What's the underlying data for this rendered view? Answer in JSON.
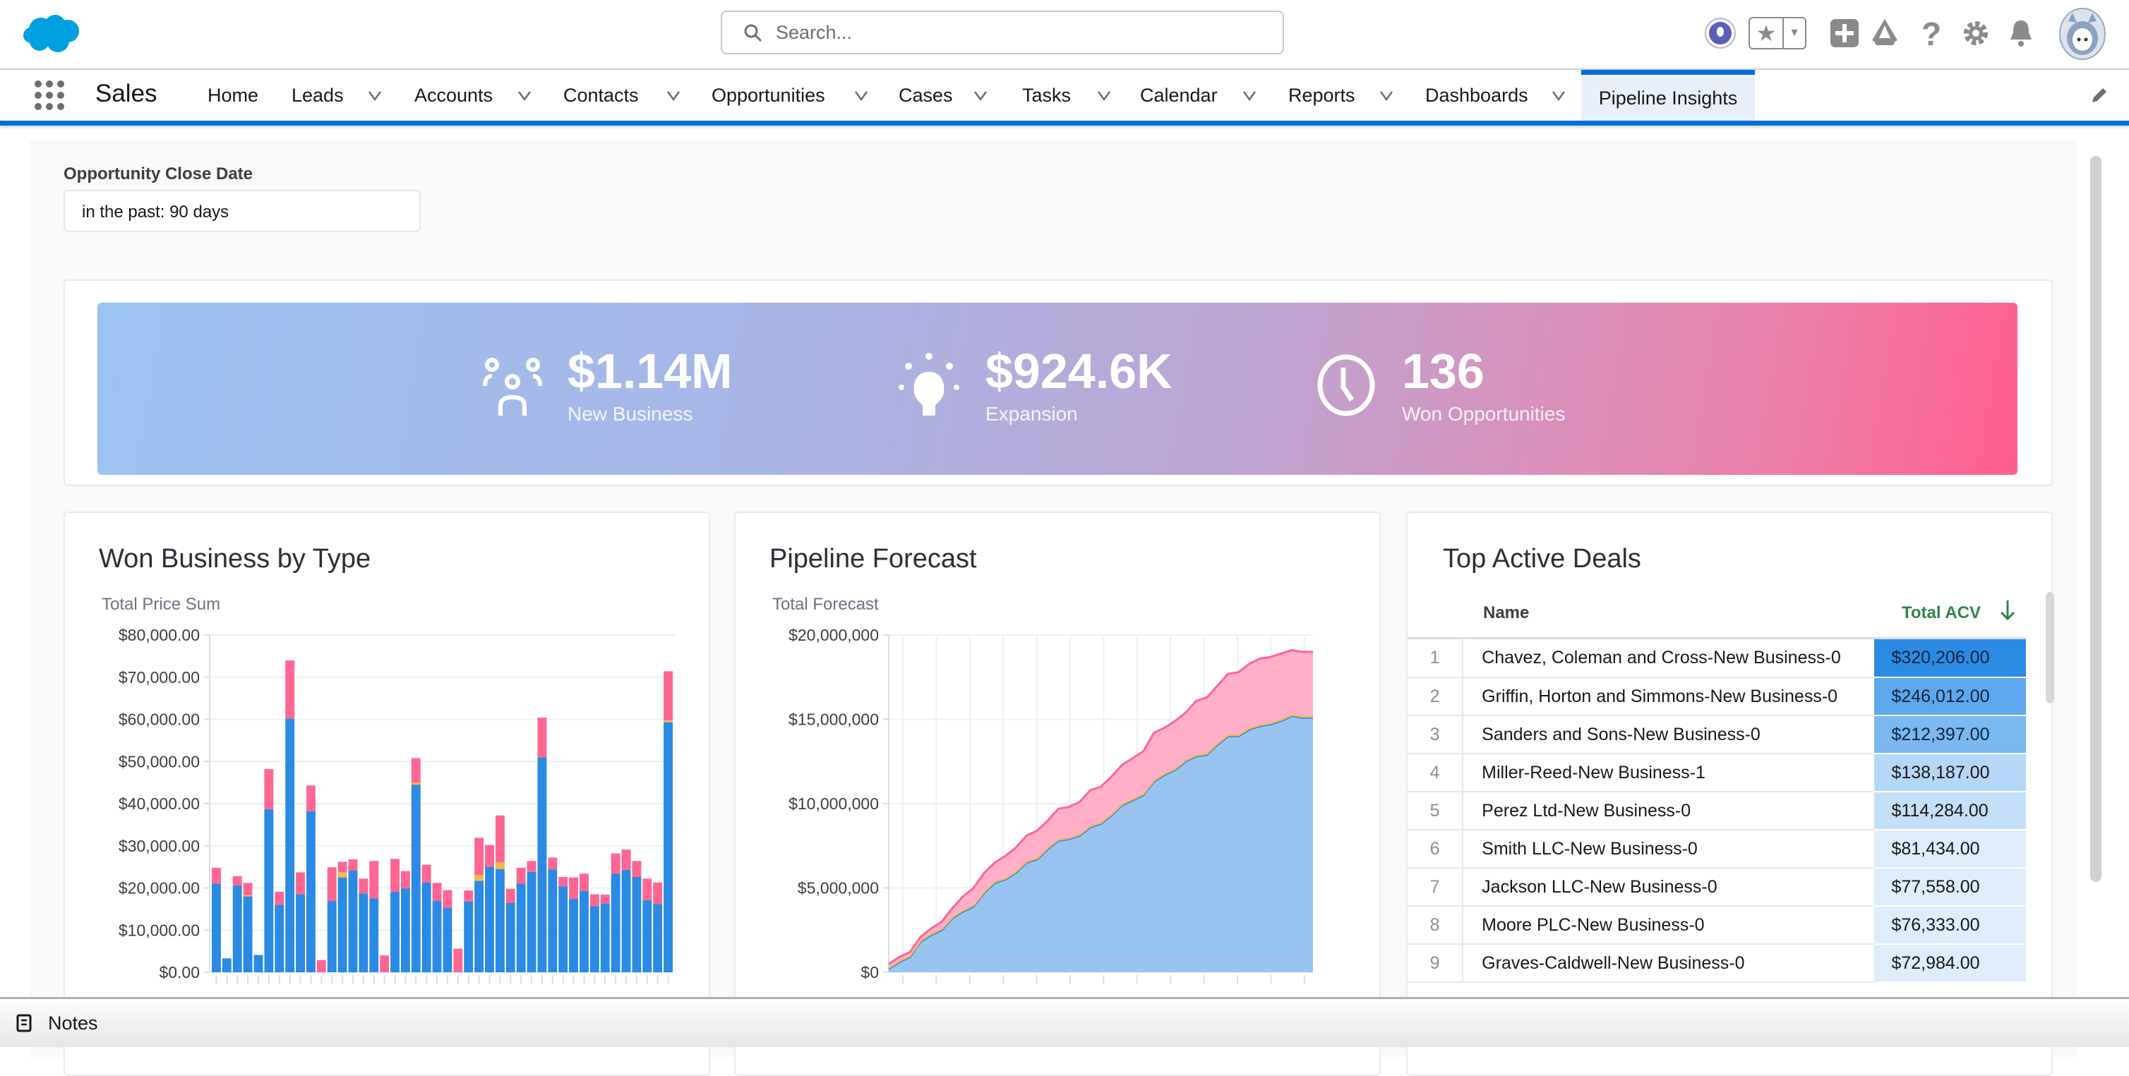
{
  "header": {
    "app_logo": "salesforce-cloud-logo",
    "search_placeholder": "Search...",
    "icons": [
      "einstein-icon",
      "favorites-star-icon",
      "favorites-dropdown-icon",
      "global-actions-plus-icon",
      "trailhead-icon",
      "help-icon",
      "setup-gear-icon",
      "notifications-bell-icon",
      "user-avatar"
    ]
  },
  "nav": {
    "app_name": "Sales",
    "items": [
      {
        "label": "Home",
        "dropdown": false
      },
      {
        "label": "Leads",
        "dropdown": true
      },
      {
        "label": "Accounts",
        "dropdown": true
      },
      {
        "label": "Contacts",
        "dropdown": true
      },
      {
        "label": "Opportunities",
        "dropdown": true
      },
      {
        "label": "Cases",
        "dropdown": true
      },
      {
        "label": "Tasks",
        "dropdown": true
      },
      {
        "label": "Calendar",
        "dropdown": true
      },
      {
        "label": "Reports",
        "dropdown": true
      },
      {
        "label": "Dashboards",
        "dropdown": true
      }
    ],
    "active_tab": "Pipeline Insights"
  },
  "filter": {
    "label": "Opportunity Close Date",
    "value": "in the past: 90 days"
  },
  "kpis": [
    {
      "value": "$1.14M",
      "label": "New Business",
      "icon": "group-people-icon"
    },
    {
      "value": "$924.6K",
      "label": "Expansion",
      "icon": "lightbulb-icon"
    },
    {
      "value": "136",
      "label": "Won Opportunities",
      "icon": "clock-icon"
    }
  ],
  "colors": {
    "accent": "#0070d2",
    "bar_blue": "#2a8ae4",
    "bar_pink": "#ff6692",
    "bar_orange": "#f8b54c",
    "area_blue": "#9ac4f0",
    "area_pink": "#ffb0c8",
    "acv_header": "#2e844a"
  },
  "chart_data": [
    {
      "type": "bar",
      "stacked": true,
      "title": "Won Business by Type",
      "ylabel": "Total Price Sum",
      "ylim": [
        0,
        80000
      ],
      "yticks": [
        "$0.00",
        "$10,000.00",
        "$20,000.00",
        "$30,000.00",
        "$40,000.00",
        "$50,000.00",
        "$60,000.00",
        "$70,000.00",
        "$80,000.00"
      ],
      "grid": true,
      "series": [
        {
          "color": "#2a8ae4",
          "values": [
            21000,
            3300,
            20600,
            18000,
            4100,
            38700,
            16000,
            60200,
            18500,
            38200,
            0,
            16900,
            22500,
            24100,
            18700,
            17500,
            0,
            19100,
            19900,
            44500,
            21300,
            16900,
            15300,
            0,
            16800,
            21700,
            25000,
            24500,
            16400,
            21000,
            23800,
            51000,
            24400,
            20400,
            17400,
            19300,
            15700,
            16300,
            23400,
            24300,
            22600,
            17100,
            16200,
            59300
          ]
        },
        {
          "color": "#f8b54c",
          "values": [
            0,
            0,
            0,
            300,
            0,
            0,
            0,
            0,
            0,
            0,
            0,
            0,
            1200,
            0,
            0,
            0,
            0,
            0,
            0,
            500,
            0,
            0,
            0,
            0,
            0,
            1400,
            0,
            1600,
            0,
            0,
            0,
            0,
            0,
            0,
            0,
            0,
            0,
            0,
            0,
            0,
            0,
            0,
            0,
            500
          ]
        },
        {
          "color": "#ff6692",
          "values": [
            3800,
            0,
            2200,
            2900,
            0,
            9500,
            3100,
            13800,
            5200,
            6100,
            2900,
            8000,
            2500,
            2700,
            3500,
            8900,
            4000,
            7800,
            4100,
            5800,
            4200,
            4300,
            4200,
            5600,
            2600,
            8800,
            5200,
            11100,
            3400,
            3800,
            2600,
            9400,
            2800,
            2200,
            5100,
            4100,
            2800,
            2100,
            4800,
            4800,
            3800,
            5100,
            5100,
            11600
          ]
        }
      ]
    },
    {
      "type": "area",
      "stacked": true,
      "title": "Pipeline Forecast",
      "ylabel": "Total Forecast",
      "ylim": [
        0,
        20000000
      ],
      "yticks": [
        "$0",
        "$5,000,000",
        "$10,000,000",
        "$15,000,000",
        "$20,000,000"
      ],
      "grid": true,
      "series": [
        {
          "color": "#9ac4f0",
          "values": [
            200000,
            600000,
            900000,
            1800000,
            2200000,
            2500000,
            3200000,
            3600000,
            3900000,
            4700000,
            5300000,
            5500000,
            5900000,
            6500000,
            6700000,
            7300000,
            7800000,
            7900000,
            8100000,
            8600000,
            8800000,
            9300000,
            9900000,
            10200000,
            10500000,
            11300000,
            11700000,
            12000000,
            12500000,
            12800000,
            12900000,
            13500000,
            14000000,
            14000000,
            14400000,
            14600000,
            14700000,
            14900000,
            15200000,
            15100000,
            15100000
          ]
        },
        {
          "color": "#f8b54c",
          "values": [
            100000,
            100000,
            100000,
            100000,
            100000,
            100000,
            100000,
            100000,
            100000,
            100000,
            100000,
            100000,
            100000,
            100000,
            100000,
            100000,
            100000,
            100000,
            100000,
            100000,
            100000,
            100000,
            100000,
            100000,
            100000,
            100000,
            100000,
            100000,
            100000,
            100000,
            100000,
            100000,
            100000,
            100000,
            100000,
            100000,
            100000,
            100000,
            100000,
            100000,
            100000
          ]
        },
        {
          "color": "#ff6692",
          "values": [
            200000,
            200000,
            200000,
            200000,
            300000,
            400000,
            500000,
            800000,
            1000000,
            1100000,
            1100000,
            1300000,
            1400000,
            1500000,
            1600000,
            1600000,
            1800000,
            1800000,
            1900000,
            2100000,
            2100000,
            2200000,
            2300000,
            2400000,
            2500000,
            2800000,
            2700000,
            2800000,
            2800000,
            3200000,
            3300000,
            3400000,
            3600000,
            3700000,
            3800000,
            3900000,
            3900000,
            3900000,
            3800000,
            3800000,
            3800000
          ]
        }
      ]
    }
  ],
  "deals": {
    "title": "Top Active Deals",
    "columns": [
      "Name",
      "Total ACV"
    ],
    "sort": "descending",
    "rows": [
      {
        "n": "1",
        "name": "Chavez, Coleman and Cross-New Business-0",
        "acv": "$320,206.00",
        "bg": "#2b8ae3",
        "fg": "#10243e"
      },
      {
        "n": "2",
        "name": "Griffin, Horton and Simmons-New Business-0",
        "acv": "$246,012.00",
        "bg": "#5fa7ec",
        "fg": "#10243e"
      },
      {
        "n": "3",
        "name": "Sanders and Sons-New Business-0",
        "acv": "$212,397.00",
        "bg": "#7ab8ef",
        "fg": "#10243e"
      },
      {
        "n": "4",
        "name": "Miller-Reed-New Business-1",
        "acv": "$138,187.00",
        "bg": "#b5d7f7",
        "fg": "#181818"
      },
      {
        "n": "5",
        "name": "Perez Ltd-New Business-0",
        "acv": "$114,284.00",
        "bg": "#c4dff8",
        "fg": "#181818"
      },
      {
        "n": "6",
        "name": "Smith LLC-New Business-0",
        "acv": "$81,434.00",
        "bg": "#deecfb",
        "fg": "#181818"
      },
      {
        "n": "7",
        "name": "Jackson LLC-New Business-0",
        "acv": "$77,558.00",
        "bg": "#deecfb",
        "fg": "#181818"
      },
      {
        "n": "8",
        "name": "Moore PLC-New Business-0",
        "acv": "$76,333.00",
        "bg": "#deecfb",
        "fg": "#181818"
      },
      {
        "n": "9",
        "name": "Graves-Caldwell-New Business-0",
        "acv": "$72,984.00",
        "bg": "#deecfb",
        "fg": "#181818"
      }
    ]
  },
  "footer": {
    "notes_label": "Notes"
  }
}
